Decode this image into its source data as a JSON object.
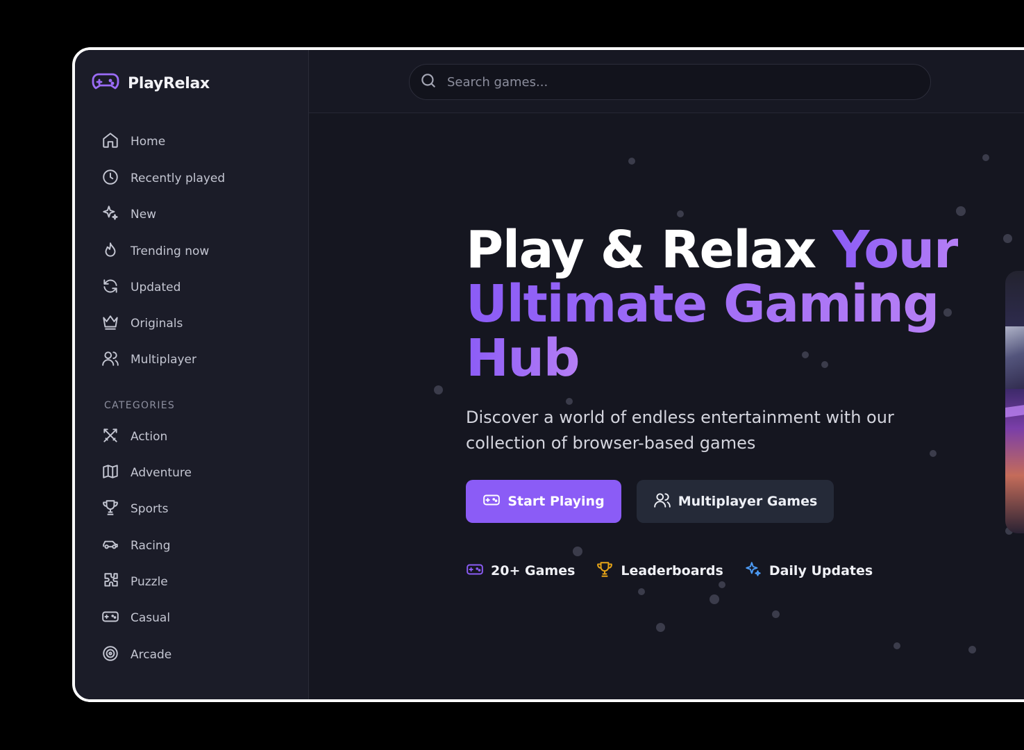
{
  "app": {
    "brand_name": "PlayRelax"
  },
  "sidebar": {
    "nav_items": [
      {
        "label": "Home",
        "icon": "home-icon"
      },
      {
        "label": "Recently played",
        "icon": "clock-icon"
      },
      {
        "label": "New",
        "icon": "sparkles-icon"
      },
      {
        "label": "Trending now",
        "icon": "flame-icon"
      },
      {
        "label": "Updated",
        "icon": "refresh-icon"
      },
      {
        "label": "Originals",
        "icon": "crown-icon"
      },
      {
        "label": "Multiplayer",
        "icon": "users-icon"
      }
    ],
    "categories_title": "CATEGORIES",
    "categories": [
      {
        "label": "Action",
        "icon": "swords-icon"
      },
      {
        "label": "Adventure",
        "icon": "map-icon"
      },
      {
        "label": "Sports",
        "icon": "trophy-icon"
      },
      {
        "label": "Racing",
        "icon": "car-icon"
      },
      {
        "label": "Puzzle",
        "icon": "puzzle-icon"
      },
      {
        "label": "Casual",
        "icon": "gamepad-icon"
      },
      {
        "label": "Arcade",
        "icon": "target-icon"
      }
    ]
  },
  "search": {
    "placeholder": "Search games..."
  },
  "hero": {
    "title_white": "Play & Relax ",
    "title_accent_1": "Your",
    "title_accent_2": "Ultimate Gaming",
    "title_accent_3": "Hub",
    "subtitle": "Discover a world of endless entertainment with our collection of browser-based games",
    "primary_button": "Start Playing",
    "secondary_button": "Multiplayer Games",
    "features": [
      {
        "label": "20+ Games",
        "icon": "gamepad-icon",
        "color": "#8b5cf6"
      },
      {
        "label": "Leaderboards",
        "icon": "trophy-icon",
        "color": "#e6a417"
      },
      {
        "label": "Daily Updates",
        "icon": "sparkles-icon",
        "color": "#4c9bf5"
      }
    ]
  },
  "colors": {
    "accent": "#8b5cf6",
    "background": "#151620",
    "sidebar": "#1b1c28"
  }
}
